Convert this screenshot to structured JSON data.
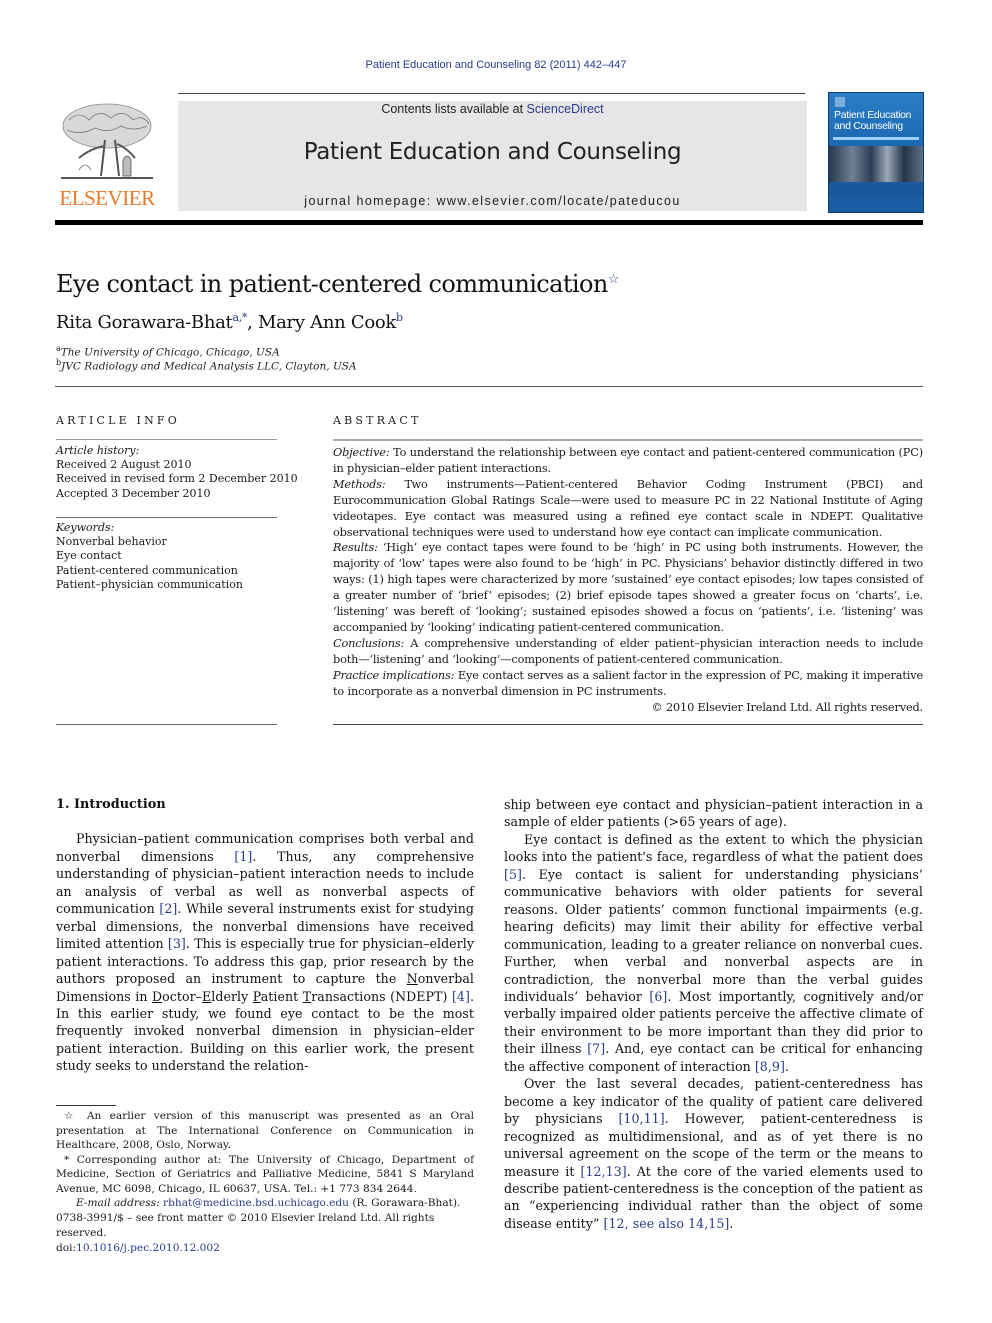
{
  "header": {
    "journal_ref": "Patient Education and Counseling 82 (2011) 442–447",
    "contents_prefix": "Contents lists available at ",
    "contents_link": "ScienceDirect",
    "journal_title": "Patient Education and Counseling",
    "homepage": "journal homepage: www.elsevier.com/locate/pateducou",
    "publisher_logo_text": "ELSEVIER",
    "cover_title_line1": "Patient Education",
    "cover_title_line2": "and Counseling"
  },
  "colors": {
    "link": "#2a3a8a",
    "elsevier_orange": "#e8792a",
    "banner_gray": "#e6e6e6",
    "cover_blue": "#1d6ab3"
  },
  "article": {
    "title": "Eye contact in patient-centered communication",
    "title_mark": "☆",
    "authors": [
      {
        "name": "Rita Gorawara-Bhat",
        "sup": "a,*"
      },
      {
        "name": "Mary Ann Cook",
        "sup": "b"
      }
    ],
    "author_separator": ", ",
    "affiliations": [
      {
        "mark": "a",
        "text": "The University of Chicago, Chicago, USA"
      },
      {
        "mark": "b",
        "text": "JVC Radiology and Medical Analysis LLC, Clayton, USA"
      }
    ]
  },
  "article_info": {
    "heading": "ARTICLE INFO",
    "history_label": "Article history:",
    "history": [
      "Received 2 August 2010",
      "Received in revised form 2 December 2010",
      "Accepted 3 December 2010"
    ],
    "keywords_label": "Keywords:",
    "keywords": [
      "Nonverbal behavior",
      "Eye contact",
      "Patient-centered communication",
      "Patient–physician communication"
    ]
  },
  "abstract": {
    "heading": "ABSTRACT",
    "sections": [
      {
        "label": "Objective:",
        "text": " To understand the relationship between eye contact and patient-centered communication (PC) in physician–elder patient interactions."
      },
      {
        "label": "Methods:",
        "text": "  Two instruments—Patient-centered Behavior Coding Instrument (PBCI) and Eurocommunication Global Ratings Scale—were used to measure PC in 22 National Institute of Aging videotapes. Eye contact was measured using a refined eye contact scale in NDEPT. Qualitative observational techniques were used to understand how eye contact can implicate communication."
      },
      {
        "label": "Results:",
        "text": "  ‘High’ eye contact tapes were found to be ‘high’ in PC using both instruments. However, the majority of ‘low’ tapes were also found to be ‘high’ in PC. Physicians’ behavior distinctly differed in two ways: (1) high tapes were characterized by more ‘sustained’ eye contact episodes; low tapes consisted of a greater number of ‘brief’ episodes; (2) brief episode tapes showed a greater focus on ‘charts’, i.e. ‘listening’ was bereft of ‘looking’; sustained episodes showed a focus on ‘patients’, i.e. ‘listening’ was accompanied by ‘looking’ indicating patient-centered communication."
      },
      {
        "label": "Conclusions:",
        "text": "  A comprehensive understanding of elder patient–physician interaction needs to include both—‘listening’ and ‘looking’—components of patient-centered communication."
      },
      {
        "label": "Practice implications:",
        "text": "  Eye contact serves as a salient factor in the expression of PC, making it imperative to incorporate as a nonverbal dimension in PC instruments."
      }
    ],
    "copyright": "© 2010 Elsevier Ireland Ltd. All rights reserved."
  },
  "body": {
    "section_heading": "1.  Introduction",
    "left_paragraph": {
      "t1": "Physician–patient communication comprises both verbal and nonverbal dimensions ",
      "r1": "[1]",
      "t2": ". Thus, any comprehensive understanding of physician–patient interaction needs to include an analysis of verbal as well as nonverbal aspects of communication ",
      "r2": "[2]",
      "t3": ". While several instruments exist for studying verbal dimensions, the nonverbal dimensions have received limited attention ",
      "r3": "[3]",
      "t4": ". This is especially true for physician–elderly patient interactions. To address this gap, prior research by the authors proposed an instrument to capture the ",
      "n_u": "N",
      "n_rest": "onverbal Dimensions in ",
      "d_u": "D",
      "d_rest": "octor–",
      "e_u": "E",
      "e_rest": "lderly ",
      "p_u": "P",
      "p_rest": "atient ",
      "tr_u": "T",
      "tr_rest": "ransactions (NDEPT) ",
      "r4": "[4]",
      "t5": ". In this earlier study, we found eye contact to be the most frequently invoked nonverbal dimension in physician–elder patient interaction. Building on this earlier work, the present study seeks to understand the relation-"
    },
    "right_p1": "ship between eye contact and physician–patient interaction in a sample of elder patients (>65 years of age).",
    "right_p2": {
      "t1": "Eye contact is defined as the extent to which the physician looks into the patient's face, regardless of what the patient does ",
      "r5": "[5]",
      "t2": ". Eye contact is salient for understanding physicians’ communicative behaviors with older patients for several reasons. Older patients’ common functional impairments (e.g. hearing deficits) may limit their ability for effective verbal communication, leading to a greater reliance on nonverbal cues. Further, when verbal and nonverbal aspects are in contradiction, the nonverbal more than the verbal guides individuals’ behavior ",
      "r6": "[6]",
      "t3": ". Most importantly, cognitively and/or verbally impaired older patients perceive the affective climate of their environment to be more important than they did prior to their illness ",
      "r7": "[7]",
      "t4": ". And, eye contact can be critical for enhancing the affective component of interaction ",
      "r8": "[8,9]",
      "t5": "."
    },
    "right_p3": {
      "t1": "Over the last several decades, patient-centeredness has become a key indicator of the quality of patient care delivered by physicians ",
      "r10": "[10,11]",
      "t2": ". However, patient-centeredness is recognized as multidimensional, and as of yet there is no universal agreement on the scope of the term or the means to measure it ",
      "r12": "[12,13]",
      "t3": ". At the core of the varied elements used to describe patient-centeredness is the conception of the patient as an “experiencing individual rather than the object of some disease entity” ",
      "r14": "[12, see also 14,15]",
      "t4": "."
    }
  },
  "footnotes": {
    "star_mark": "☆",
    "star_text": "  An earlier version of this manuscript was presented as an Oral presentation at The International Conference on Communication in Healthcare, 2008, Oslo, Norway.",
    "corr_mark": "*",
    "corr_text": " Corresponding author at: The University of Chicago, Department of Medicine, Section of Geriatrics and Palliative Medicine, 5841 S Maryland Avenue, MC 6098, Chicago, IL 60637, USA. Tel.: +1 773 834 2644.",
    "email_label": "E-mail address:",
    "email": "rbhat@medicine.bsd.uchicago.edu",
    "email_suffix": " (R. Gorawara-Bhat).",
    "front_matter": "0738-3991/$ – see front matter © 2010 Elsevier Ireland Ltd. All rights reserved.",
    "doi_label": "doi:",
    "doi": "10.1016/j.pec.2010.12.002"
  }
}
